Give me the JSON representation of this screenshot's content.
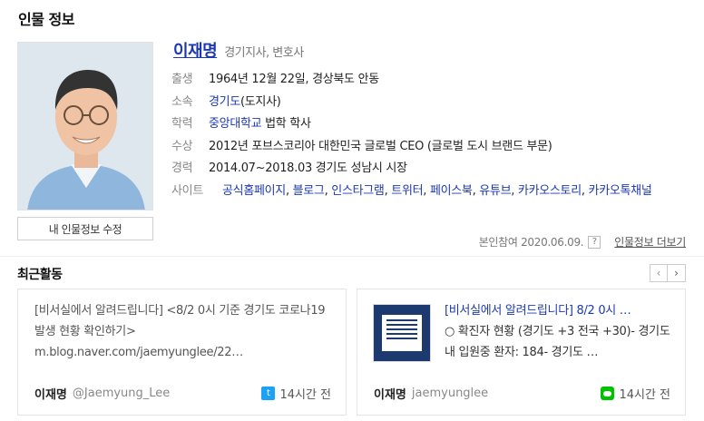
{
  "section_title": "인물 정보",
  "profile": {
    "name": "이재명",
    "job": "경기지사, 변호사",
    "edit_button": "내 인물정보 수정",
    "rows": [
      {
        "label": "출생",
        "value": "1964년 12월 22일, 경상북도 안동"
      },
      {
        "label": "소속",
        "link": "경기도",
        "value": "(도지사)"
      },
      {
        "label": "학력",
        "link": "중앙대학교",
        "value": " 법학 학사"
      },
      {
        "label": "수상",
        "value": "2012년 포브스코리아 대한민국 글로벌 CEO (글로벌 도시 브랜드 부문)"
      },
      {
        "label": "경력",
        "value": "2014.07~2018.03 경기도 성남시 시장"
      }
    ],
    "site_label": "사이트",
    "sites": [
      "공식홈페이지",
      "블로그",
      "인스타그램",
      "트위터",
      "페이스북",
      "유튜브",
      "카카오스토리",
      "카카오톡채널"
    ]
  },
  "meta": {
    "self_participation": "본인참여 2020.06.09.",
    "question": "?",
    "more": "인물정보 더보기"
  },
  "recent": {
    "title": "최근활동",
    "prev": "‹",
    "next": "›",
    "cards": [
      {
        "text": "[비서실에서 알려드립니다] <8/2 0시 기준 경기도 코로나19 발생 현황 확인하기> m.blog.naver.com/jaemyunglee/22…",
        "author": "이재명",
        "handle": "@Jaemyung_Lee",
        "time": "14시간 전",
        "source_icon": "twitter-icon"
      },
      {
        "text_highlight": "[비서실에서 알려드립니다] 8/2 0시 …",
        "text": "○ 확진자 현황 (경기도 +3 전국 +30)- 경기도 내 입원중 환자: 184- 경기도 …",
        "author": "이재명",
        "handle": "jaemyunglee",
        "time": "14시간 전",
        "source_icon": "line-icon"
      }
    ]
  },
  "colors": {
    "link": "#1c39b1",
    "twitter": "#1da1f2",
    "line": "#00c300"
  }
}
